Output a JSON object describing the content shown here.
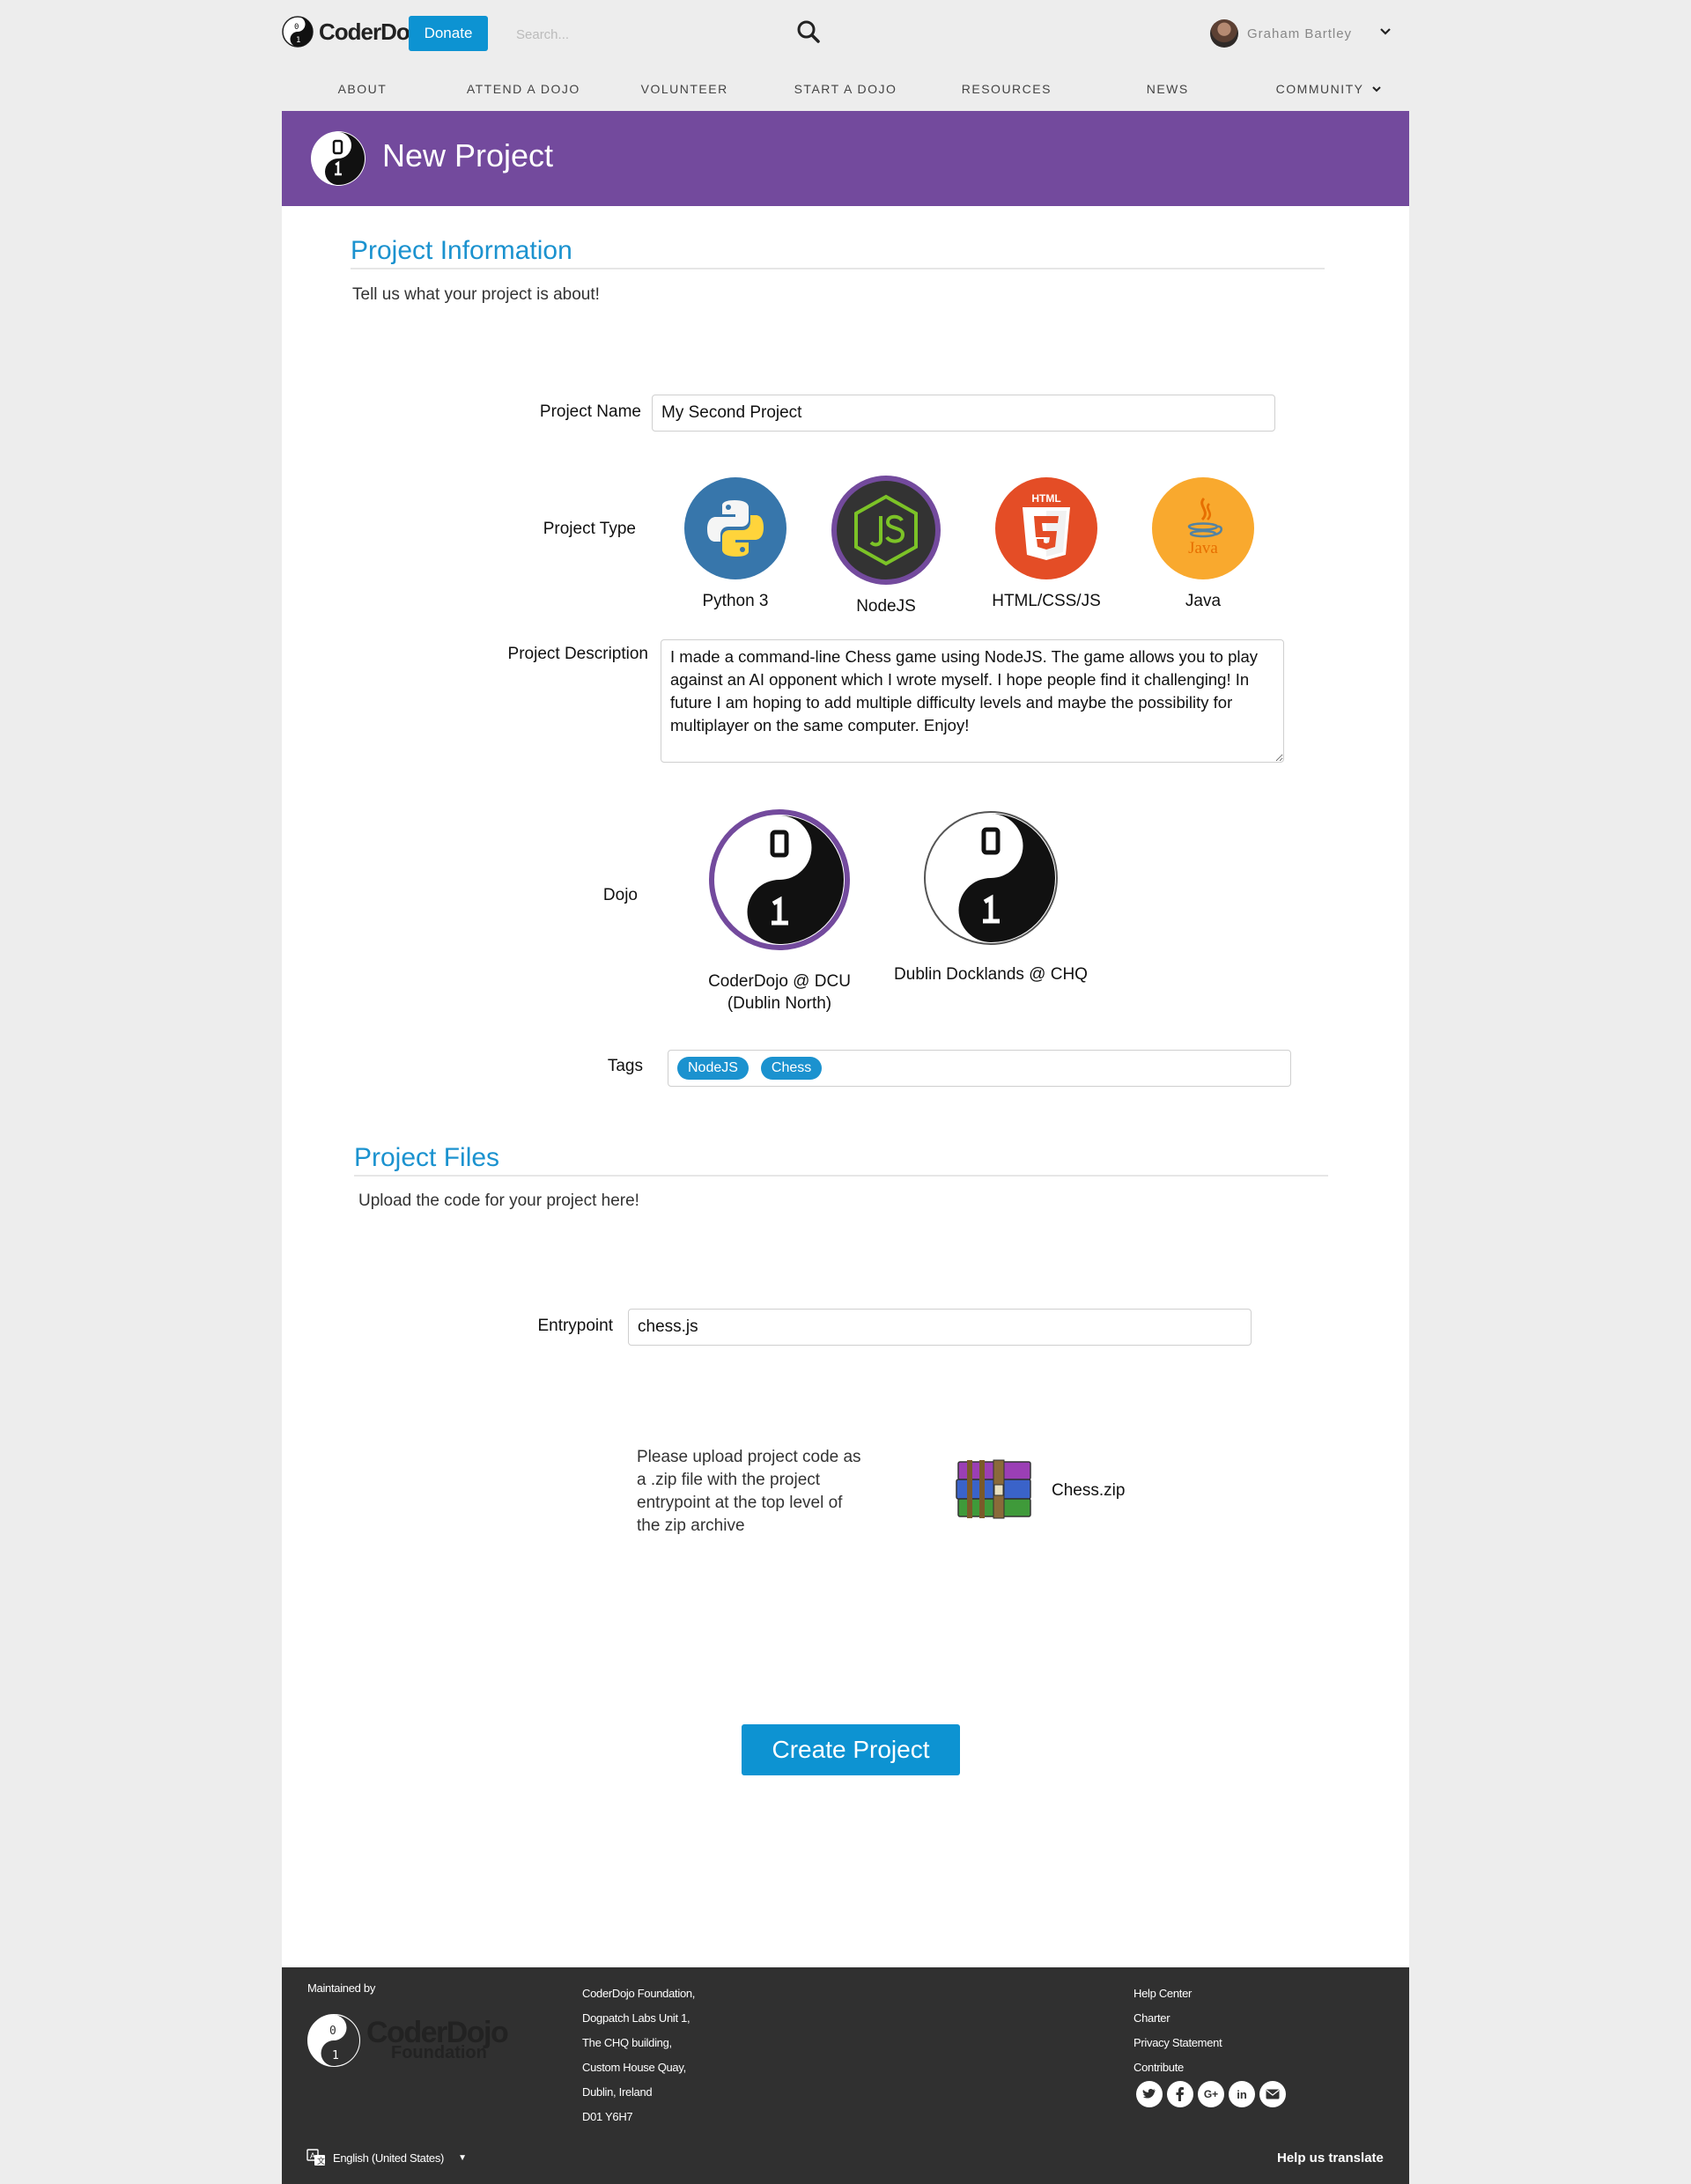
{
  "header": {
    "logo_text": "CoderDojo",
    "donate_label": "Donate",
    "search_placeholder": "Search...",
    "user_name": "Graham Bartley"
  },
  "nav": {
    "items": [
      "ABOUT",
      "ATTEND A DOJO",
      "VOLUNTEER",
      "START A DOJO",
      "RESOURCES",
      "NEWS",
      "COMMUNITY"
    ]
  },
  "page": {
    "title": "New Project"
  },
  "project_info": {
    "section_title": "Project Information",
    "subtitle": "Tell us what your project is about!",
    "name_label": "Project Name",
    "name_value": "My Second Project",
    "type_label": "Project Type",
    "types": [
      {
        "label": "Python 3",
        "icon": "python-icon",
        "selected": false
      },
      {
        "label": "NodeJS",
        "icon": "nodejs-icon",
        "selected": true
      },
      {
        "label": "HTML/CSS/JS",
        "icon": "html5-icon",
        "selected": false
      },
      {
        "label": "Java",
        "icon": "java-icon",
        "selected": false
      }
    ],
    "description_label": "Project Description",
    "description_value": "I made a command-line Chess game using NodeJS. The game allows you to play against an AI opponent which I wrote myself. I hope people find it challenging! In future I am hoping to add multiple difficulty levels and maybe the possibility for multiplayer on the same computer. Enjoy!",
    "dojo_label": "Dojo",
    "dojos": [
      {
        "line1": "CoderDojo @ DCU",
        "line2": "(Dublin North)",
        "selected": true
      },
      {
        "line1": "Dublin Docklands @ CHQ",
        "line2": "",
        "selected": false
      }
    ],
    "tags_label": "Tags",
    "tags": [
      "NodeJS",
      "Chess"
    ]
  },
  "project_files": {
    "section_title": "Project Files",
    "subtitle": "Upload the code for your project here!",
    "entrypoint_label": "Entrypoint",
    "entrypoint_value": "chess.js",
    "upload_instructions": [
      "Please upload project code as",
      "a .zip file with the project",
      "entrypoint at the top level of",
      "the zip archive"
    ],
    "file_name": "Chess.zip"
  },
  "actions": {
    "create_label": "Create Project"
  },
  "footer": {
    "maintained_by": "Maintained by",
    "foundation_logo_line1": "CoderDojo",
    "foundation_logo_line2": "Foundation",
    "address": [
      "CoderDojo Foundation,",
      "Dogpatch Labs Unit 1,",
      "The CHQ building,",
      "Custom House Quay,",
      "Dublin, Ireland",
      "D01 Y6H7"
    ],
    "links": [
      "Help Center",
      "Charter",
      "Privacy Statement",
      "Contribute"
    ],
    "social_icons": [
      "twitter-icon",
      "facebook-icon",
      "google-plus-icon",
      "linkedin-icon",
      "email-icon"
    ],
    "language": "English (United States)",
    "help_translate": "Help us translate"
  },
  "colors": {
    "primary_blue": "#0d93d2",
    "purple": "#734a9d",
    "footer_bg": "#303030",
    "page_bg": "#ededed"
  }
}
